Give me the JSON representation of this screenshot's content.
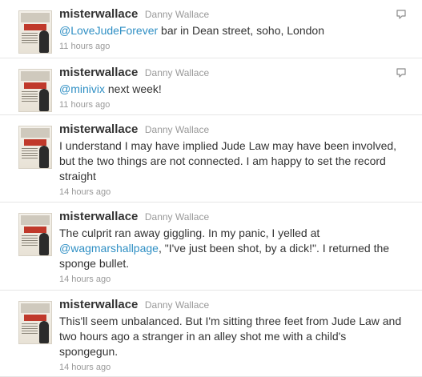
{
  "tweets": [
    {
      "screen_name": "misterwallace",
      "full_name": "Danny Wallace",
      "mention": "@LoveJudeForever",
      "text_after": " bar in Dean street, soho, London",
      "time": "11 hours ago",
      "icon": "reply-bubble-icon"
    },
    {
      "screen_name": "misterwallace",
      "full_name": "Danny Wallace",
      "mention": "@minivix",
      "text_after": " next week!",
      "time": "11 hours ago",
      "icon": "reply-bubble-icon"
    },
    {
      "screen_name": "misterwallace",
      "full_name": "Danny Wallace",
      "text": "I understand I may have implied Jude Law may have been involved, but the two things are not connected. I am happy to set the record straight",
      "time": "14 hours ago"
    },
    {
      "screen_name": "misterwallace",
      "full_name": "Danny Wallace",
      "text_before": "The culprit ran away giggling. In my panic, I yelled at ",
      "mention": "@wagmarshallpage",
      "text_after": ", \"I've just been shot, by a dick!\". I returned the sponge bullet.",
      "time": "14 hours ago"
    },
    {
      "screen_name": "misterwallace",
      "full_name": "Danny Wallace",
      "text": "This'll seem unbalanced. But I'm sitting three feet from Jude Law and two hours ago a stranger in an alley shot me with a child's spongegun.",
      "time": "14 hours ago"
    }
  ]
}
